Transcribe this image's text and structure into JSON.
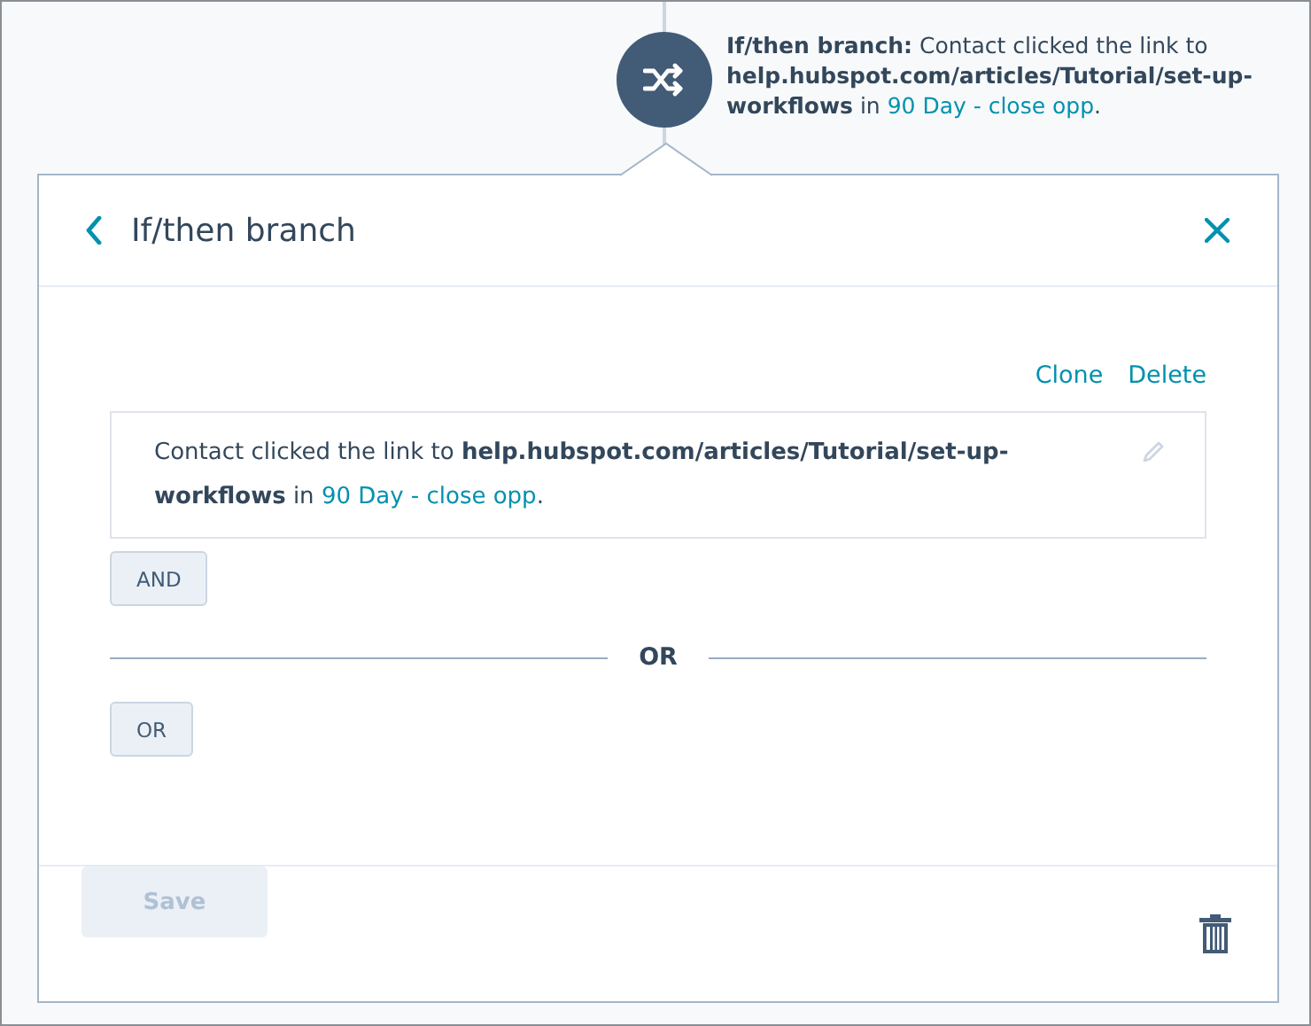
{
  "node": {
    "title": "If/then branch:",
    "text": "Contact clicked the link to **help.hubspot.com/articles/Tutorial/set-up-workflows** in",
    "link": "90 Day - close opp",
    "end": "."
  },
  "panel": {
    "title": "If/then branch"
  },
  "actions": [
    "Clone",
    "Delete"
  ],
  "condition": {
    "text": "Contact clicked the link to **help.hubspot.com/articles/Tutorial/set-up-workflows** in",
    "link": "90 Day - close opp",
    "end": "."
  },
  "and_button": "AND",
  "divider": "OR",
  "or_button": "OR",
  "save": {
    "label": "Save",
    "disabled": true
  }
}
